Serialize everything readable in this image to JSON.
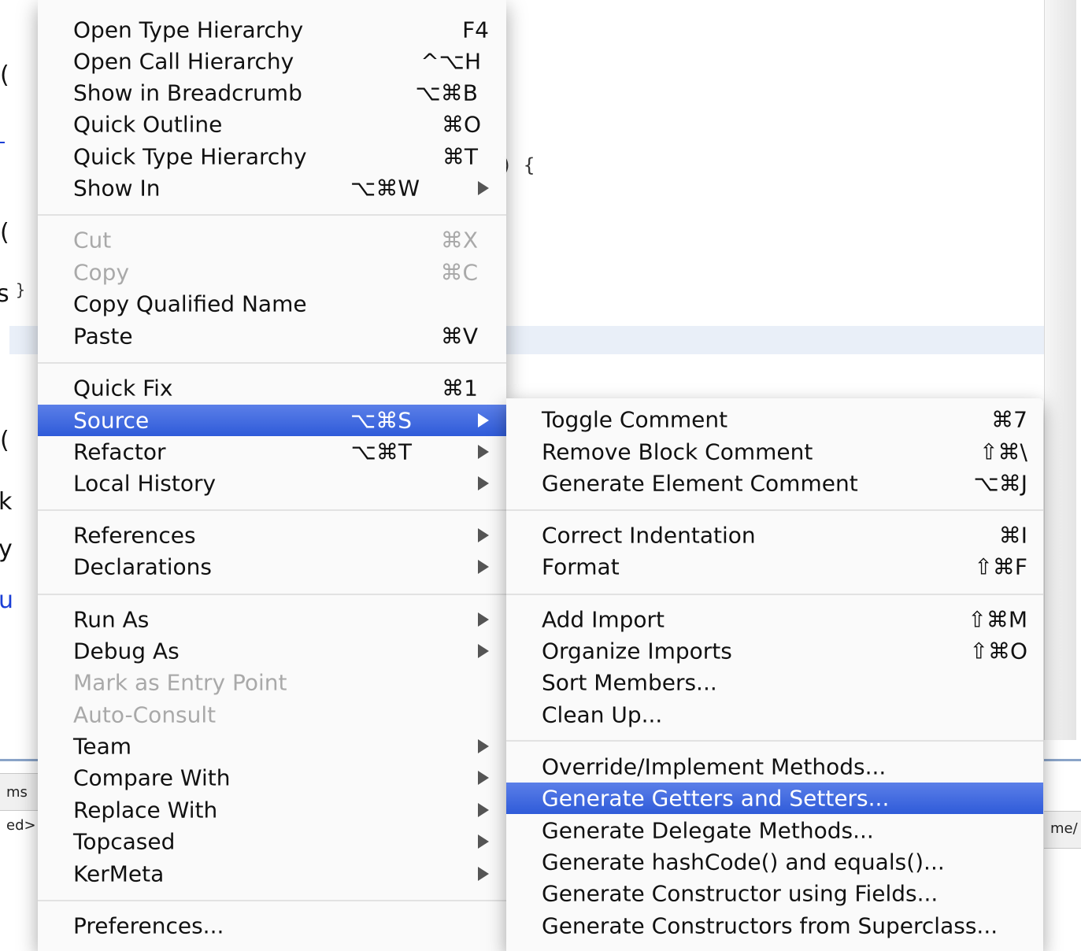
{
  "background": {
    "code_brace": ") {",
    "code_brace2": "}",
    "frag_c1": "(",
    "frag_c2": "(",
    "frag_s": "s",
    "frag_c3": "(",
    "frag_k": "k",
    "frag_y": "y",
    "link_u": "u",
    "tab_ms": "ms",
    "tab_ed": "ed>",
    "tab_me": "me/"
  },
  "main_menu": {
    "items": [
      {
        "label": "Open Type Hierarchy",
        "shortcut": "F4"
      },
      {
        "label": "Open Call Hierarchy",
        "shortcut": "^⌥H"
      },
      {
        "label": "Show in Breadcrumb",
        "shortcut": "⌥⌘B"
      },
      {
        "label": "Quick Outline",
        "shortcut": "⌘O"
      },
      {
        "label": "Quick Type Hierarchy",
        "shortcut": "⌘T"
      },
      {
        "label": "Show In",
        "shortcut": "⌥⌘W"
      },
      {
        "label": "Cut",
        "shortcut": "⌘X"
      },
      {
        "label": "Copy",
        "shortcut": "⌘C"
      },
      {
        "label": "Copy Qualified Name",
        "shortcut": ""
      },
      {
        "label": "Paste",
        "shortcut": "⌘V"
      },
      {
        "label": "Quick Fix",
        "shortcut": "⌘1"
      },
      {
        "label": "Source",
        "shortcut": "⌥⌘S"
      },
      {
        "label": "Refactor",
        "shortcut": "⌥⌘T"
      },
      {
        "label": "Local History",
        "shortcut": ""
      },
      {
        "label": "References",
        "shortcut": ""
      },
      {
        "label": "Declarations",
        "shortcut": ""
      },
      {
        "label": "Run As",
        "shortcut": ""
      },
      {
        "label": "Debug As",
        "shortcut": ""
      },
      {
        "label": "Mark as Entry Point",
        "shortcut": ""
      },
      {
        "label": "Auto-Consult",
        "shortcut": ""
      },
      {
        "label": "Team",
        "shortcut": ""
      },
      {
        "label": "Compare With",
        "shortcut": ""
      },
      {
        "label": "Replace With",
        "shortcut": ""
      },
      {
        "label": "Topcased",
        "shortcut": ""
      },
      {
        "label": "KerMeta",
        "shortcut": ""
      },
      {
        "label": "Preferences...",
        "shortcut": ""
      }
    ]
  },
  "source_submenu": {
    "items": [
      {
        "label": "Toggle Comment",
        "shortcut": "⌘7"
      },
      {
        "label": "Remove Block Comment",
        "shortcut": "⇧⌘\\"
      },
      {
        "label": "Generate Element Comment",
        "shortcut": "⌥⌘J"
      },
      {
        "label": "Correct Indentation",
        "shortcut": "⌘I"
      },
      {
        "label": "Format",
        "shortcut": "⇧⌘F"
      },
      {
        "label": "Add Import",
        "shortcut": "⇧⌘M"
      },
      {
        "label": "Organize Imports",
        "shortcut": "⇧⌘O"
      },
      {
        "label": "Sort Members...",
        "shortcut": ""
      },
      {
        "label": "Clean Up...",
        "shortcut": ""
      },
      {
        "label": "Override/Implement Methods...",
        "shortcut": ""
      },
      {
        "label": "Generate Getters and Setters...",
        "shortcut": ""
      },
      {
        "label": "Generate Delegate Methods...",
        "shortcut": ""
      },
      {
        "label": "Generate hashCode() and equals()...",
        "shortcut": ""
      },
      {
        "label": "Generate Constructor using Fields...",
        "shortcut": ""
      },
      {
        "label": "Generate Constructors from Superclass...",
        "shortcut": ""
      }
    ]
  },
  "colors": {
    "highlight": "#3a63dc",
    "disabled_text": "#a9a9a9",
    "link": "#1b3fd6"
  }
}
